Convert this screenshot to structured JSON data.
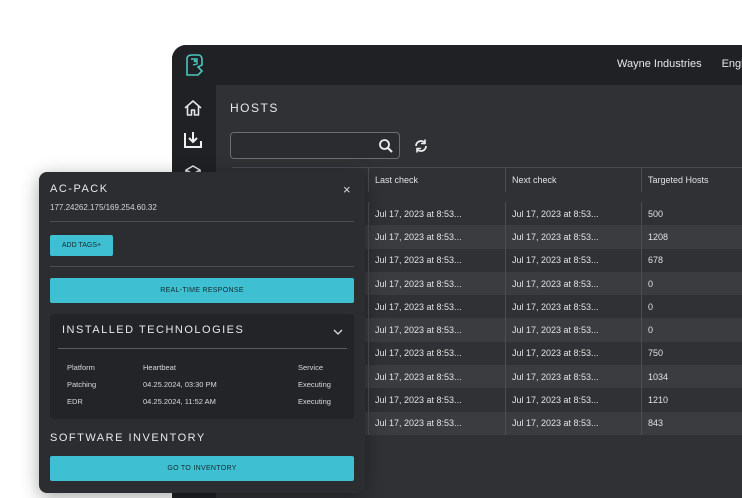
{
  "header": {
    "org": "Wayne Industries",
    "lang": "Engli"
  },
  "hosts": {
    "title": "HOSTS",
    "search_placeholder": "",
    "columns": [
      "",
      "Last check",
      "Next check",
      "Targeted Hosts"
    ],
    "rows": [
      {
        "last": "Jul 17, 2023 at 8:53...",
        "next": "Jul 17, 2023 at 8:53...",
        "targeted": "500"
      },
      {
        "last": "Jul 17, 2023 at 8:53...",
        "next": "Jul 17, 2023 at 8:53...",
        "targeted": "1208"
      },
      {
        "last": "Jul 17, 2023 at 8:53...",
        "next": "Jul 17, 2023 at 8:53...",
        "targeted": "678"
      },
      {
        "last": "Jul 17, 2023 at 8:53...",
        "next": "Jul 17, 2023 at 8:53...",
        "targeted": "0"
      },
      {
        "last": "Jul 17, 2023 at 8:53...",
        "next": "Jul 17, 2023 at 8:53...",
        "targeted": "0"
      },
      {
        "last": "Jul 17, 2023 at 8:53...",
        "next": "Jul 17, 2023 at 8:53...",
        "targeted": "0"
      },
      {
        "last": "Jul 17, 2023 at 8:53...",
        "next": "Jul 17, 2023 at 8:53...",
        "targeted": "750"
      },
      {
        "last": "Jul 17, 2023 at 8:53...",
        "next": "Jul 17, 2023 at 8:53...",
        "targeted": "1034"
      },
      {
        "last": "Jul 17, 2023 at 8:53...",
        "next": "Jul 17, 2023 at 8:53...",
        "targeted": "1210"
      },
      {
        "last": "Jul 17, 2023 at 8:53...",
        "next": "Jul 17, 2023 at 8:53...",
        "targeted": "843"
      }
    ]
  },
  "panel": {
    "title": "AC-PACK",
    "close": "×",
    "ip": "177.24262.175/169.254.60.32",
    "add_tags": "ADD TAGS+",
    "realtime": "REAL-TIME RESPONSE",
    "tech_title": "INSTALLED TECHNOLOGIES",
    "tech_rows": [
      {
        "a": "Platform",
        "b": "Heartbeat",
        "c": "Service"
      },
      {
        "a": "Patching",
        "b": "04.25.2024, 03:30 PM",
        "c": "Executing"
      },
      {
        "a": "EDR",
        "b": "04.25.2024, 11:52 AM",
        "c": "Executing"
      }
    ],
    "software_title": "SOFTWARE INVENTORY",
    "goto": "GO TO INVENTORY"
  },
  "colors": {
    "accent": "#3ec0d2",
    "logo": "#49c7bd",
    "window_bg": "#2c2e31",
    "sidebar_bg": "#1f2124"
  },
  "icons": [
    "logo-icon",
    "home-icon",
    "download-icon",
    "package-icon",
    "search-icon",
    "refresh-icon",
    "close-icon",
    "chevron-down-icon"
  ]
}
